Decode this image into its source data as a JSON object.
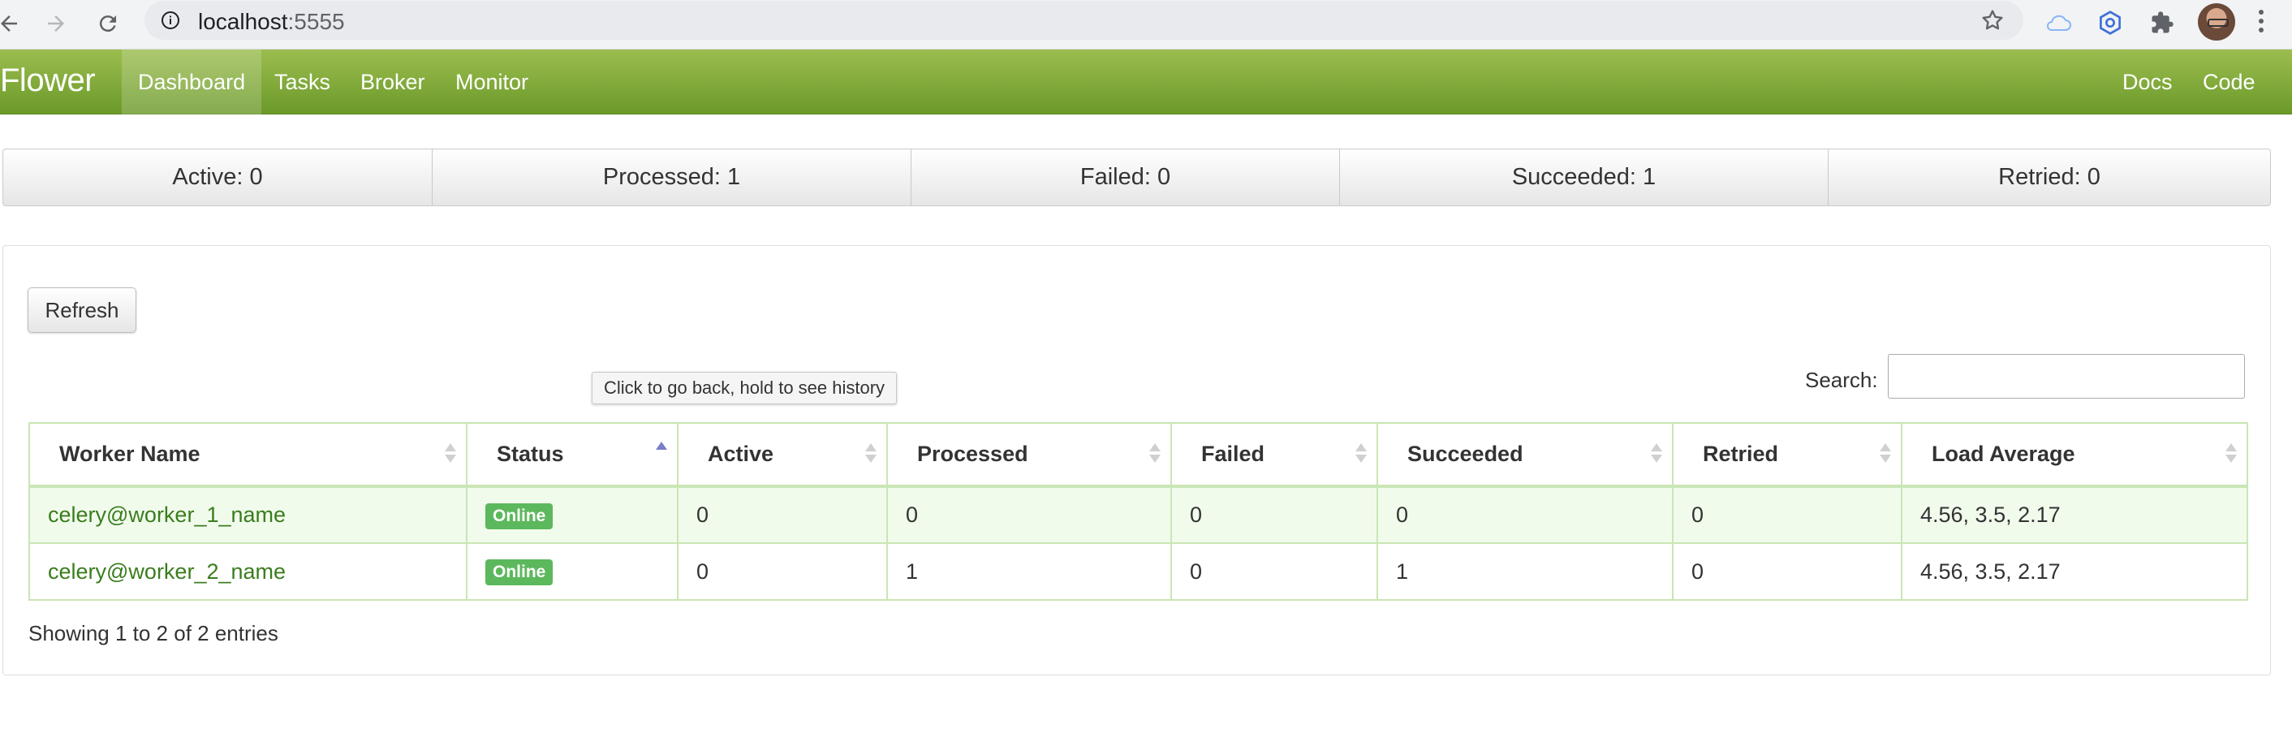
{
  "browser": {
    "url_host": "localhost",
    "url_port": ":5555"
  },
  "navbar": {
    "brand": "Flower",
    "items": [
      {
        "label": "Dashboard",
        "active": true
      },
      {
        "label": "Tasks",
        "active": false
      },
      {
        "label": "Broker",
        "active": false
      },
      {
        "label": "Monitor",
        "active": false
      }
    ],
    "right_items": [
      {
        "label": "Docs"
      },
      {
        "label": "Code"
      }
    ]
  },
  "stats": [
    {
      "label": "Active: 0"
    },
    {
      "label": "Processed: 1"
    },
    {
      "label": "Failed: 0"
    },
    {
      "label": "Succeeded: 1"
    },
    {
      "label": "Retried: 0"
    }
  ],
  "panel": {
    "refresh_label": "Refresh",
    "search_label": "Search:",
    "search_value": "",
    "tooltip": "Click to go back, hold to see history",
    "columns": [
      "Worker Name",
      "Status",
      "Active",
      "Processed",
      "Failed",
      "Succeeded",
      "Retried",
      "Load Average"
    ],
    "sorted_column": "Status",
    "rows": [
      {
        "name": "celery@worker_1_name",
        "status": "Online",
        "active": "0",
        "processed": "0",
        "failed": "0",
        "succeeded": "0",
        "retried": "0",
        "load": "4.56, 3.5, 2.17"
      },
      {
        "name": "celery@worker_2_name",
        "status": "Online",
        "active": "0",
        "processed": "1",
        "failed": "0",
        "succeeded": "1",
        "retried": "0",
        "load": "4.56, 3.5, 2.17"
      }
    ],
    "info": "Showing 1 to 2 of 2 entries"
  },
  "colors": {
    "navbar_top": "#9cbd4f",
    "navbar_bottom": "#6b9a2a",
    "badge_online": "#5cb85c",
    "link": "#3a7d1d"
  }
}
